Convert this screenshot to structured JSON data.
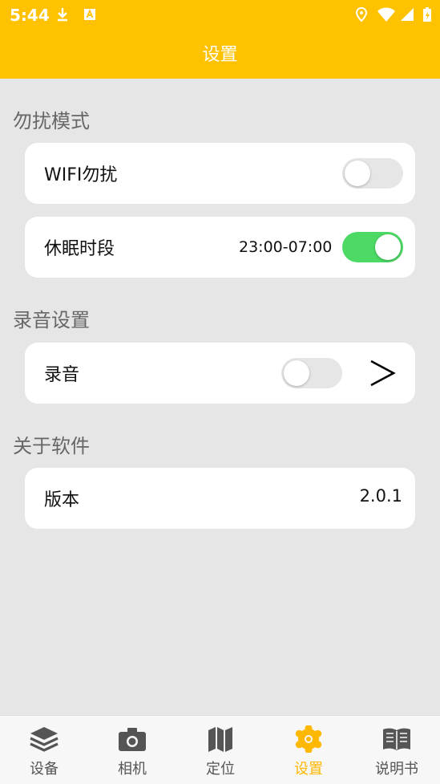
{
  "status_bar": {
    "time": "5:44"
  },
  "header": {
    "title": "设置"
  },
  "sections": {
    "dnd": {
      "title": "勿扰模式",
      "wifi": {
        "label": "WIFI勿扰",
        "enabled": false
      },
      "sleep": {
        "label": "休眠时段",
        "range": "23:00-07:00",
        "enabled": true
      }
    },
    "recording": {
      "title": "录音设置",
      "record": {
        "label": "录音",
        "enabled": false
      }
    },
    "about": {
      "title": "关于软件",
      "version": {
        "label": "版本",
        "value": "2.0.1"
      }
    }
  },
  "nav": {
    "items": [
      {
        "label": "设备",
        "icon": "layers-icon"
      },
      {
        "label": "相机",
        "icon": "camera-icon"
      },
      {
        "label": "定位",
        "icon": "map-icon"
      },
      {
        "label": "设置",
        "icon": "gear-icon",
        "active": true
      },
      {
        "label": "说明书",
        "icon": "book-icon"
      }
    ]
  },
  "colors": {
    "accent": "#ffc200",
    "toggle_on": "#4cd964",
    "background": "#e6e6e6"
  }
}
